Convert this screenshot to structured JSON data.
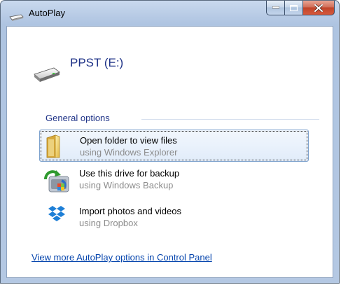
{
  "window": {
    "title": "AutoPlay"
  },
  "device": {
    "title": "PPST (E:)"
  },
  "general_options": {
    "header": "General options",
    "options": [
      {
        "label": "Open folder to view files",
        "sublabel": "using Windows Explorer",
        "icon": "folder-icon",
        "selected": true
      },
      {
        "label": "Use this drive for backup",
        "sublabel": "using Windows Backup",
        "icon": "windows-backup-icon",
        "selected": false
      },
      {
        "label": "Import photos and videos",
        "sublabel": "using Dropbox",
        "icon": "dropbox-icon",
        "selected": false
      }
    ]
  },
  "footer": {
    "link": "View more AutoPlay options in Control Panel"
  },
  "colors": {
    "heading_blue": "#1e3287",
    "link_blue": "#0645ad",
    "sublabel_gray": "#8c8c8c",
    "close_red": "#c0442a"
  }
}
